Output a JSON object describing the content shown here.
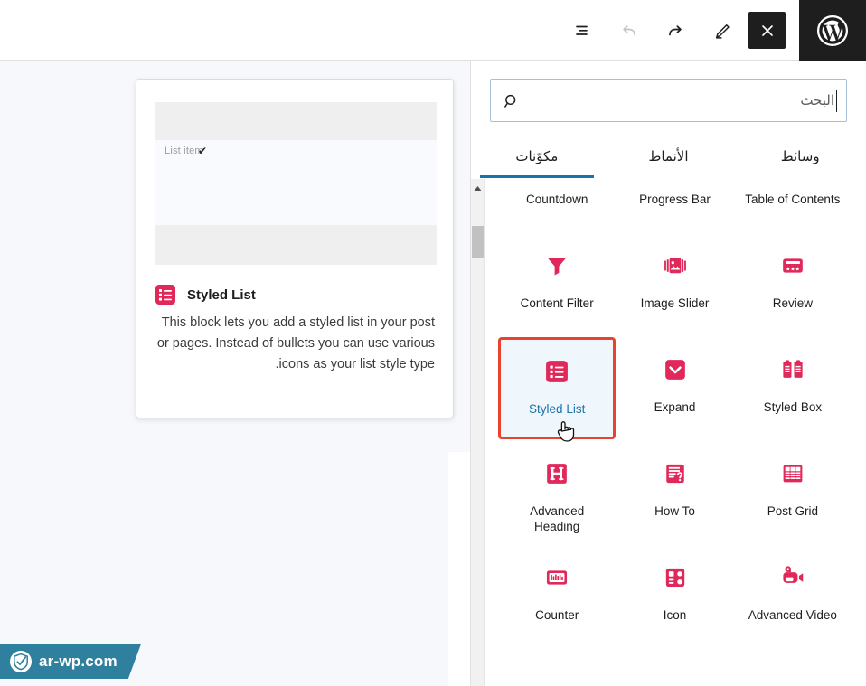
{
  "topbar": {
    "list_view_label": "List view",
    "undo_label": "Undo",
    "redo_label": "Redo",
    "edit_label": "Edit",
    "close_label": "Close block inserter",
    "wordpress_label": "WordPress"
  },
  "preview": {
    "mock_list_item": "List item",
    "mock_check": "✔",
    "title": "Styled List",
    "description": "This block lets you add a styled list in your post or pages. Instead of bullets you can use various icons as your list style type."
  },
  "inserter": {
    "search": {
      "placeholder": "البحث",
      "value": ""
    },
    "tabs": [
      {
        "label": "وسائط",
        "active": false
      },
      {
        "label": "الأنماط",
        "active": false
      },
      {
        "label": "مكوّنات",
        "active": true
      }
    ],
    "blocks": [
      {
        "label": "Table of Contents",
        "icon": "table-of-contents-icon",
        "selected": false
      },
      {
        "label": "Progress Bar",
        "icon": "progress-bar-icon",
        "selected": false
      },
      {
        "label": "Countdown",
        "icon": "countdown-icon",
        "selected": false
      },
      {
        "label": "Review",
        "icon": "review-icon",
        "selected": false
      },
      {
        "label": "Image Slider",
        "icon": "image-slider-icon",
        "selected": false
      },
      {
        "label": "Content Filter",
        "icon": "content-filter-icon",
        "selected": false
      },
      {
        "label": "Styled Box",
        "icon": "styled-box-icon",
        "selected": false
      },
      {
        "label": "Expand",
        "icon": "expand-icon",
        "selected": false
      },
      {
        "label": "Styled List",
        "icon": "styled-list-icon",
        "selected": true
      },
      {
        "label": "Post Grid",
        "icon": "post-grid-icon",
        "selected": false
      },
      {
        "label": "How To",
        "icon": "how-to-icon",
        "selected": false
      },
      {
        "label": "Advanced Heading",
        "icon": "advanced-heading-icon",
        "selected": false
      },
      {
        "label": "Advanced Video",
        "icon": "advanced-video-icon",
        "selected": false
      },
      {
        "label": "Icon",
        "icon": "icon-block-icon",
        "selected": false
      },
      {
        "label": "Counter",
        "icon": "counter-icon",
        "selected": false
      }
    ]
  },
  "watermark": {
    "text": "ar-wp.com"
  },
  "colors": {
    "block_icon": "#E0295A",
    "selection_border": "#E8432F",
    "selection_bg": "#F0F7FC",
    "tab_active_underline": "#1A73AA",
    "link_blue": "#1A73AA",
    "topbar_dark": "#1E1E1E",
    "watermark_bg": "#2F7F9E"
  }
}
